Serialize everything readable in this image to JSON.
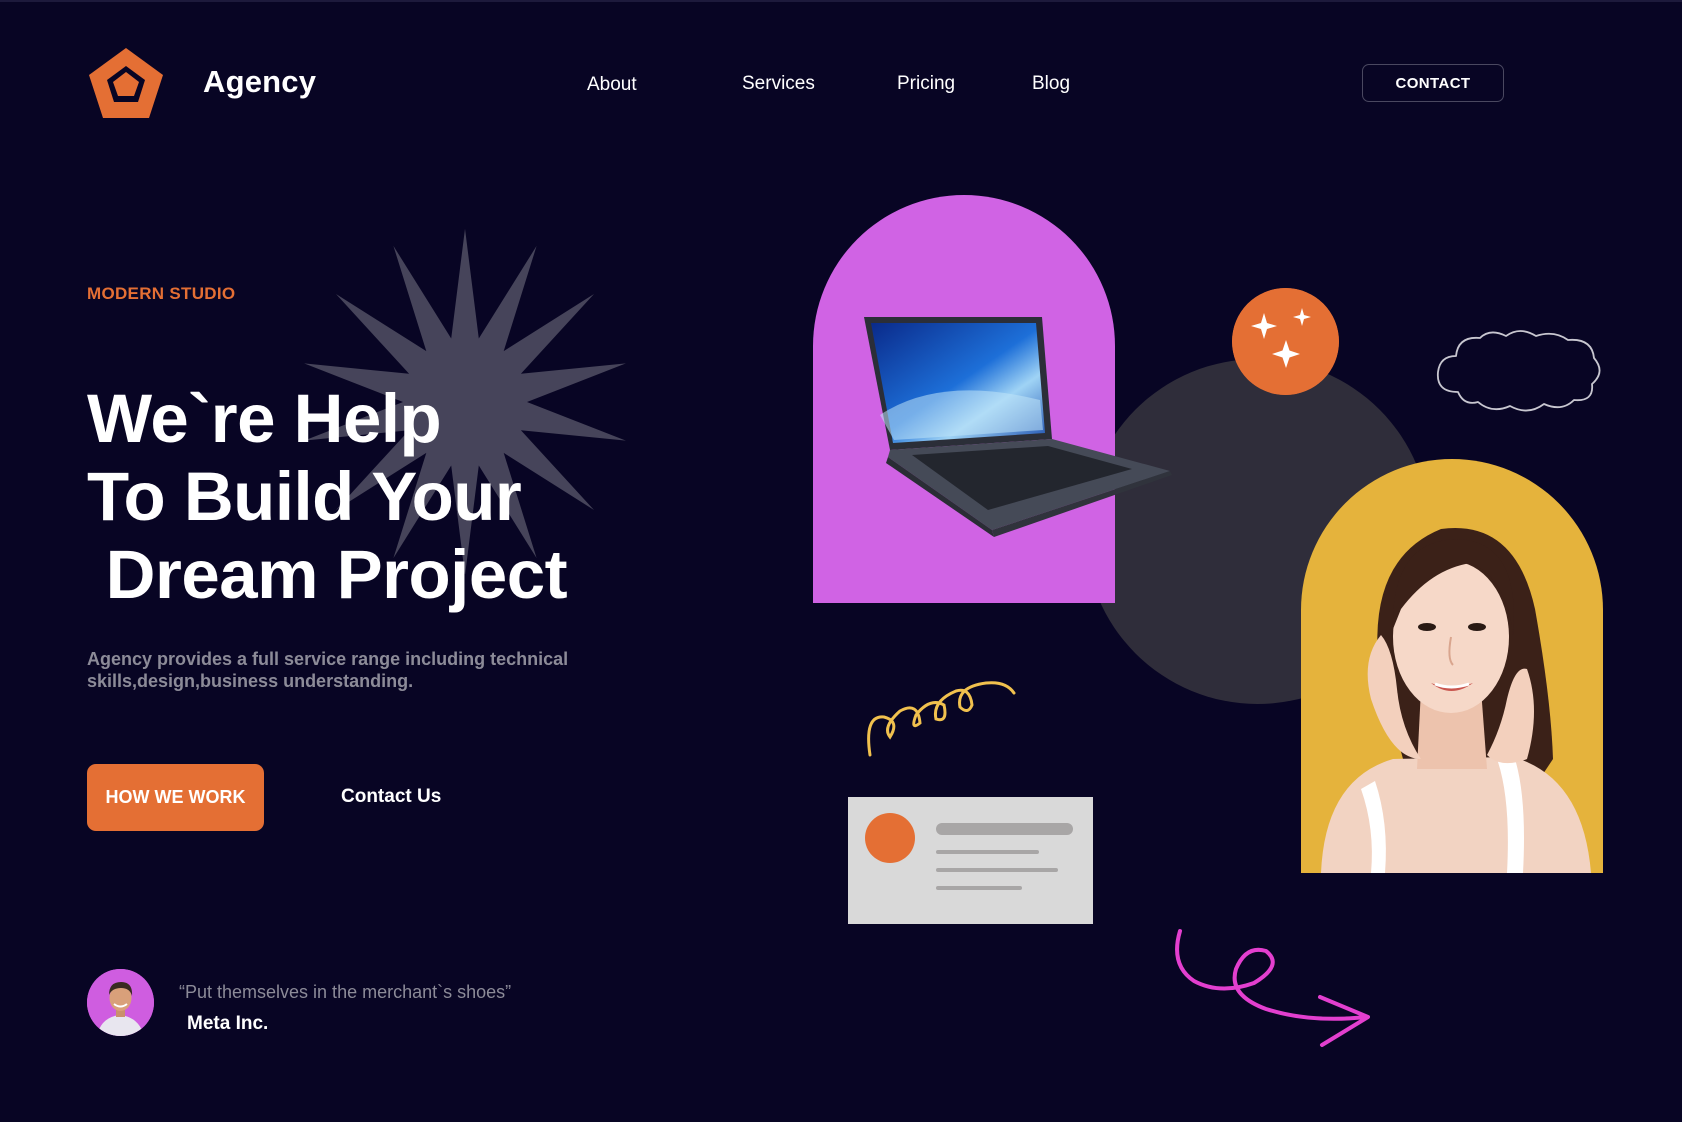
{
  "header": {
    "brand": "Agency",
    "logo_icon": "pentagon-logo-icon",
    "nav": [
      {
        "label": "About"
      },
      {
        "label": "Services"
      },
      {
        "label": "Pricing"
      },
      {
        "label": "Blog"
      }
    ],
    "contact_label": "CONTACT"
  },
  "hero": {
    "eyebrow": "MODERN STUDIO",
    "headline_lines": [
      "We`re Help",
      "To Build Your",
      " Dream Project"
    ],
    "description": "Agency provides a full service range including technical skills,design,business understanding.",
    "primary_cta": "HOW WE WORK",
    "secondary_cta": "Contact Us"
  },
  "testimonial": {
    "quote": "“Put themselves in the merchant`s shoes”",
    "author": "Meta Inc."
  },
  "colors": {
    "background": "#080524",
    "accent_orange": "#e46f34",
    "accent_purple": "#d063e4",
    "accent_yellow": "#e5b33c",
    "muted_text": "#8c8b98",
    "starburst": "#46445a",
    "pink_arrow": "#e33fcf"
  },
  "illustration": {
    "icons": [
      "starburst-shape",
      "laptop-image",
      "sparkle-icon",
      "cloud-doodle",
      "woman-portrait",
      "squiggle-doodle",
      "profile-card",
      "curly-arrow-icon"
    ]
  }
}
